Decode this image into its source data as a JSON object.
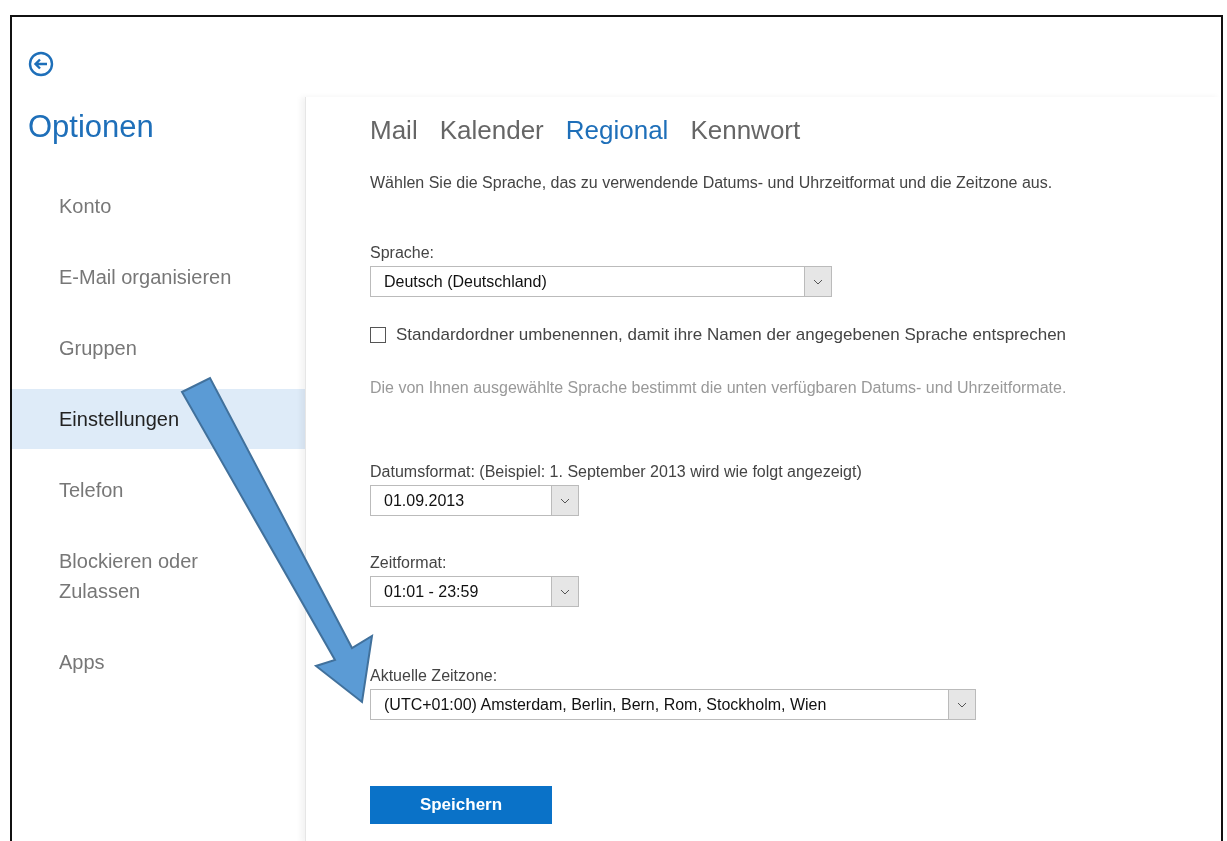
{
  "sidebar": {
    "title": "Optionen",
    "items": [
      {
        "label": "Konto",
        "selected": false
      },
      {
        "label": "E-Mail organisieren",
        "selected": false
      },
      {
        "label": "Gruppen",
        "selected": false
      },
      {
        "label": "Einstellungen",
        "selected": true
      },
      {
        "label": "Telefon",
        "selected": false
      },
      {
        "label": "Blockieren oder Zulassen",
        "selected": false
      },
      {
        "label": "Apps",
        "selected": false
      }
    ]
  },
  "tabs": [
    {
      "label": "Mail",
      "selected": false
    },
    {
      "label": "Kalender",
      "selected": false
    },
    {
      "label": "Regional",
      "selected": true
    },
    {
      "label": "Kennwort",
      "selected": false
    }
  ],
  "intro": "Wählen Sie die Sprache, das zu verwendende Datums- und Uhrzeitformat und die Zeitzone aus.",
  "language": {
    "label": "Sprache:",
    "value": "Deutsch (Deutschland)"
  },
  "rename_folders": {
    "label": "Standardordner umbenennen, damit ihre Namen der angegebenen Sprache entsprechen",
    "checked": false
  },
  "hint": "Die von Ihnen ausgewählte Sprache bestimmt die unten verfügbaren Datums- und Uhrzeitformate.",
  "date_format": {
    "label": "Datumsformat: (Beispiel: 1. September 2013 wird wie folgt angezeigt)",
    "value": "01.09.2013"
  },
  "time_format": {
    "label": "Zeitformat:",
    "value": "01:01 - 23:59"
  },
  "time_zone": {
    "label": "Aktuelle Zeitzone:",
    "value": "(UTC+01:00) Amsterdam, Berlin, Bern, Rom, Stockholm, Wien"
  },
  "save_button": "Speichern"
}
